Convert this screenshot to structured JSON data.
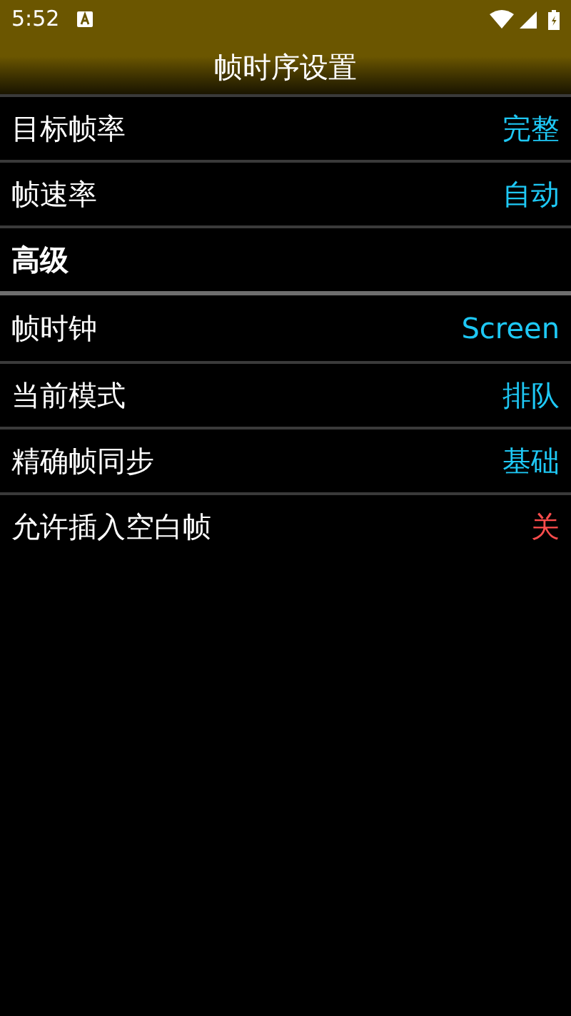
{
  "status_bar": {
    "time": "5:52"
  },
  "header": {
    "title": "帧时序设置"
  },
  "items": [
    {
      "kind": "setting",
      "label": "目标帧率",
      "value": "完整",
      "color": "#1ec8f5"
    },
    {
      "kind": "setting",
      "label": "帧速率",
      "value": "自动",
      "color": "#1ec8f5"
    },
    {
      "kind": "section",
      "label": "高级"
    },
    {
      "kind": "setting",
      "label": "帧时钟",
      "value": "Screen",
      "color": "#1ec8f5"
    },
    {
      "kind": "setting",
      "label": "当前模式",
      "value": "排队",
      "color": "#1ec8f5"
    },
    {
      "kind": "setting",
      "label": "精确帧同步",
      "value": "基础",
      "color": "#1ec8f5"
    },
    {
      "kind": "setting",
      "label": "允许插入空白帧",
      "value": "关",
      "color": "#ff4d4d"
    }
  ]
}
